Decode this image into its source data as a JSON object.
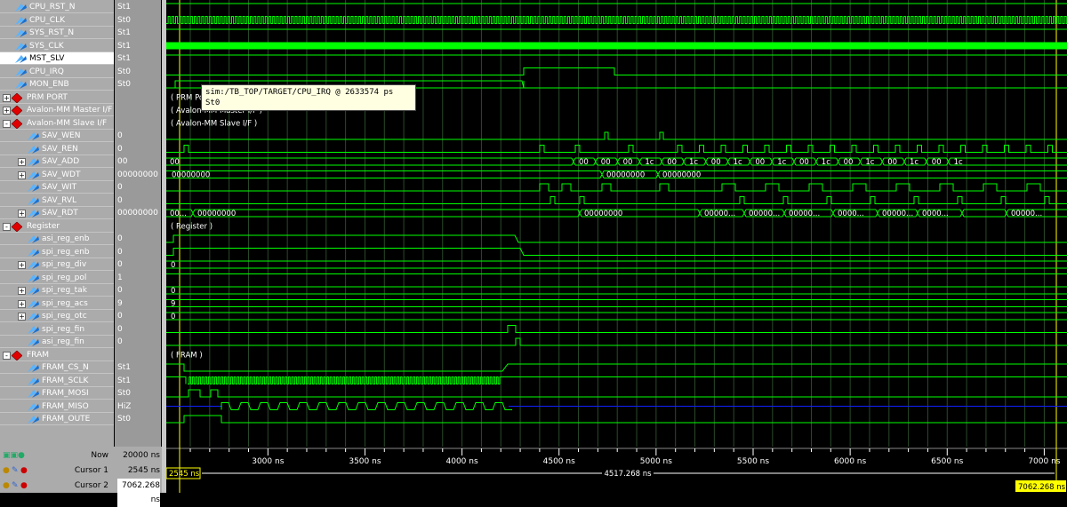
{
  "colors": {
    "wave": "#00ff00",
    "cursor": "#ffff00",
    "names_bg": "#ababab",
    "values_bg": "#9a9a9a",
    "tooltip_bg": "#ffffe1"
  },
  "signals": [
    {
      "name": "CPU_RST_N",
      "value": "St1",
      "kind": "signal",
      "indent": 0
    },
    {
      "name": "CPU_CLK",
      "value": "St0",
      "kind": "signal",
      "indent": 0
    },
    {
      "name": "SYS_RST_N",
      "value": "St1",
      "kind": "signal",
      "indent": 0
    },
    {
      "name": "SYS_CLK",
      "value": "St1",
      "kind": "signal",
      "indent": 0
    },
    {
      "name": "MST_SLV",
      "value": "St1",
      "kind": "signal",
      "indent": 0,
      "selected": true
    },
    {
      "name": "CPU_IRQ",
      "value": "St0",
      "kind": "signal",
      "indent": 0
    },
    {
      "name": "MON_ENB",
      "value": "St0",
      "kind": "signal",
      "indent": 0
    },
    {
      "name": "PRM PORT",
      "value": "",
      "kind": "group",
      "state": "+",
      "indent": 0
    },
    {
      "name": "Avalon-MM Master I/F",
      "value": "",
      "kind": "group",
      "state": "+",
      "indent": 0
    },
    {
      "name": "Avalon-MM Slave I/F",
      "value": "",
      "kind": "group",
      "state": "-",
      "indent": 0
    },
    {
      "name": "SAV_WEN",
      "value": "0",
      "kind": "signal",
      "indent": 1
    },
    {
      "name": "SAV_REN",
      "value": "0",
      "kind": "signal",
      "indent": 1
    },
    {
      "name": "SAV_ADD",
      "value": "00",
      "kind": "bus",
      "state": "+",
      "indent": 1
    },
    {
      "name": "SAV_WDT",
      "value": "00000000",
      "kind": "bus",
      "state": "+",
      "indent": 1
    },
    {
      "name": "SAV_WIT",
      "value": "0",
      "kind": "signal",
      "indent": 1
    },
    {
      "name": "SAV_RVL",
      "value": "0",
      "kind": "signal",
      "indent": 1
    },
    {
      "name": "SAV_RDT",
      "value": "00000000",
      "kind": "bus",
      "state": "+",
      "indent": 1
    },
    {
      "name": "Register",
      "value": "",
      "kind": "group",
      "state": "-",
      "indent": 0
    },
    {
      "name": "asi_reg_enb",
      "value": "0",
      "kind": "signal",
      "indent": 1
    },
    {
      "name": "spi_reg_enb",
      "value": "0",
      "kind": "signal",
      "indent": 1
    },
    {
      "name": "spi_reg_div",
      "value": "0",
      "kind": "bus",
      "state": "+",
      "indent": 1
    },
    {
      "name": "spi_reg_pol",
      "value": "1",
      "kind": "signal",
      "indent": 1
    },
    {
      "name": "spi_reg_tak",
      "value": "0",
      "kind": "bus",
      "state": "+",
      "indent": 1
    },
    {
      "name": "spi_reg_acs",
      "value": "9",
      "kind": "bus",
      "state": "+",
      "indent": 1
    },
    {
      "name": "spi_reg_otc",
      "value": "0",
      "kind": "bus",
      "state": "+",
      "indent": 1
    },
    {
      "name": "spi_reg_fin",
      "value": "0",
      "kind": "signal",
      "indent": 1
    },
    {
      "name": "asi_reg_fin",
      "value": "0",
      "kind": "signal",
      "indent": 1
    },
    {
      "name": "FRAM",
      "value": "",
      "kind": "group",
      "state": "-",
      "indent": 0
    },
    {
      "name": "FRAM_CS_N",
      "value": "St1",
      "kind": "signal",
      "indent": 1
    },
    {
      "name": "FRAM_SCLK",
      "value": "St1",
      "kind": "signal",
      "indent": 1
    },
    {
      "name": "FRAM_MOSI",
      "value": "St0",
      "kind": "signal",
      "indent": 1
    },
    {
      "name": "FRAM_MISO",
      "value": "HiZ",
      "kind": "signal",
      "indent": 1
    },
    {
      "name": "FRAM_OUTE",
      "value": "St0",
      "kind": "signal",
      "indent": 1
    }
  ],
  "group_labels": {
    "prm": "PRM Po",
    "master": "Avalon-MM Master I/F )",
    "slave": "Avalon-MM Slave I/F )",
    "register": "Register )",
    "fram": "FRAM )"
  },
  "bus_labels": {
    "sav_add_first": "00",
    "sav_add_items": [
      "00",
      "00",
      "00",
      "1c",
      "00",
      "1c",
      "00",
      "1c",
      "00",
      "1c",
      "00",
      "1c",
      "00",
      "1c",
      "00",
      "1c",
      "00",
      "1c"
    ],
    "sav_wdt": [
      "00000000",
      "00000000",
      "00000000"
    ],
    "sav_rdt": [
      "00...",
      "00000000",
      "00000000",
      "00000...",
      "00000...",
      "00000...",
      "0000...",
      "00000...",
      "0000...",
      "00000..."
    ],
    "spi_reg_div": "0",
    "spi_reg_tak": "0",
    "spi_reg_acs": "9",
    "spi_reg_otc": "0"
  },
  "tooltip": {
    "line1": "sim:/TB_TOP/TARGET/CPU_IRQ @ 2633574 ps",
    "line2": "St0"
  },
  "bottom": {
    "now_label": "Now",
    "now_value": "20000 ns",
    "cursor1_label": "Cursor 1",
    "cursor1_value": "2545 ns",
    "cursor2_label": "Cursor 2",
    "cursor2_value": "7062.268 ns"
  },
  "timeline": {
    "ticks": [
      "3000 ns",
      "3500 ns",
      "4000 ns",
      "4500 ns",
      "5000 ns",
      "5500 ns",
      "6000 ns",
      "6500 ns",
      "7000 ns"
    ],
    "cursor1_tag": "2545 ns",
    "delta": "4517.268 ns",
    "cursor2_tag": "7062.268 ns"
  }
}
